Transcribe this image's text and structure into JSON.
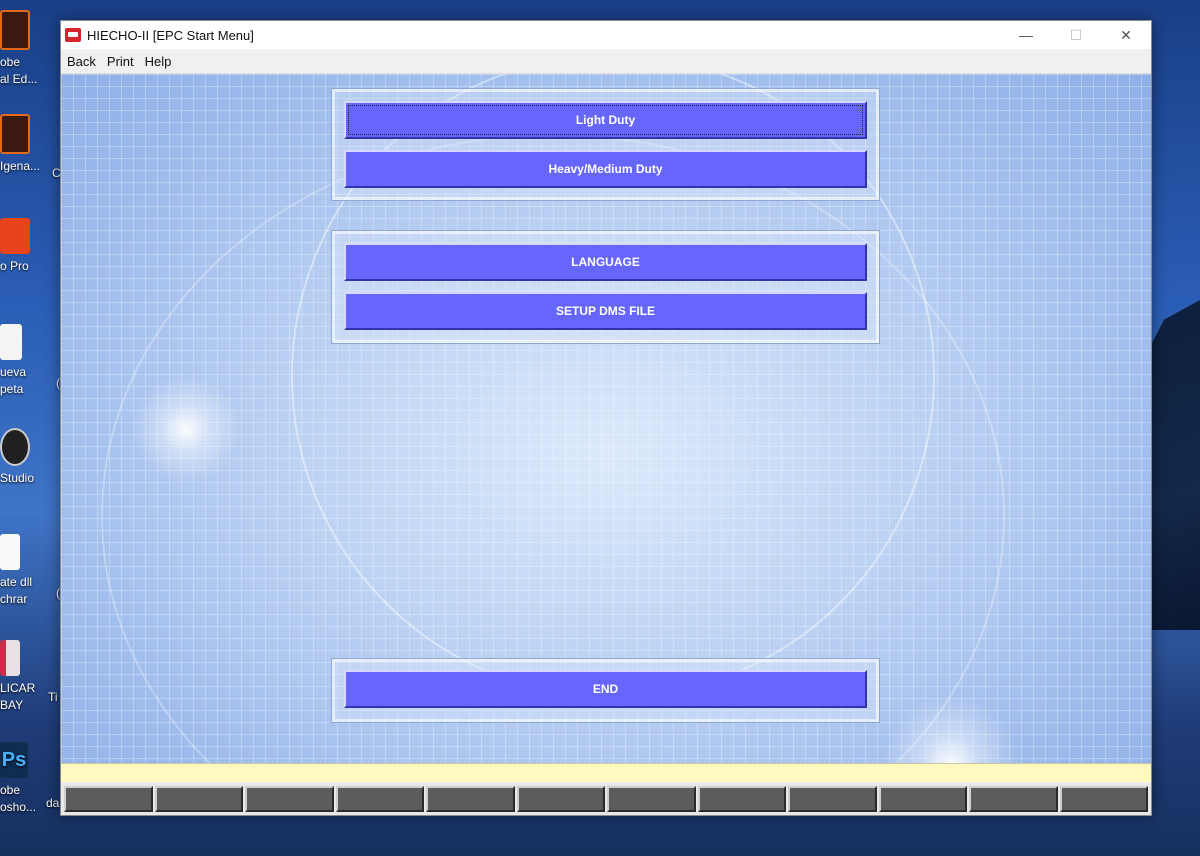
{
  "desktop": {
    "icons": [
      {
        "label": "obe\nal Ed...",
        "icon": "acrobat-book-icon",
        "color": "#c8102e"
      },
      {
        "label": "Igena...",
        "icon": "acrobat-book-icon",
        "color": "#c8102e"
      },
      {
        "label": "o Pro",
        "icon": "acrobat-pro-icon",
        "color": "#e8431a"
      },
      {
        "label": "ueva\npeta",
        "icon": "folder-icon",
        "color": "#ffffff"
      },
      {
        "label": "Studio",
        "icon": "obs-studio-icon",
        "color": "#222222"
      },
      {
        "label": "ate dll\nchrar",
        "icon": "file-icon",
        "color": "#ffffff"
      },
      {
        "label": "LICAR\nBAY",
        "icon": "archive-icon",
        "color": "#c82e4a"
      },
      {
        "label": "obe\nosho...",
        "icon": "photoshop-icon",
        "color": "#0f2d4e"
      }
    ],
    "second_column": [
      "C",
      "(",
      "(",
      "Ti",
      "da"
    ]
  },
  "window": {
    "title": "HIECHO-II [EPC Start Menu]",
    "controls": {
      "minimize": "—",
      "maximize": "☐",
      "close": "✕"
    }
  },
  "menu": {
    "back": "Back",
    "print": "Print",
    "help": "Help"
  },
  "duty_group": {
    "light_duty": "Light Duty",
    "heavy_medium_duty": "Heavy/Medium Duty"
  },
  "settings_group": {
    "language": "LANGUAGE",
    "setup_dms_file": "SETUP DMS FILE"
  },
  "end_group": {
    "end": "END"
  },
  "status_bar": {
    "text": ""
  },
  "fkeys": [
    "",
    "",
    "",
    "",
    "",
    "",
    "",
    "",
    "",
    "",
    "",
    ""
  ]
}
